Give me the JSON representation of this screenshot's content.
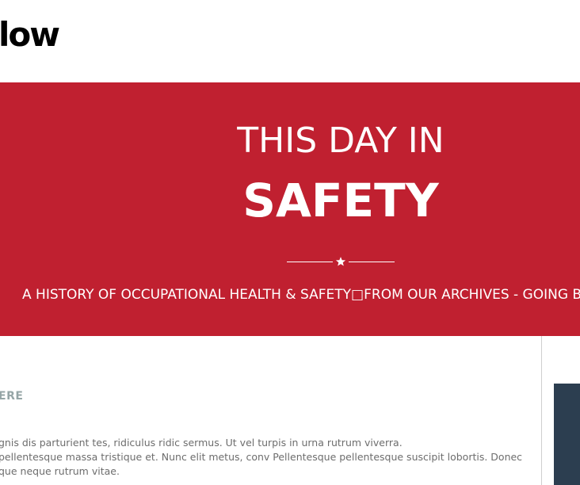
{
  "header": {
    "logo_text": "low"
  },
  "hero": {
    "line1": "THIS DAY IN",
    "line2": "SAFETY",
    "divider_icon": "star-icon",
    "tagline": "A HISTORY OF OCCUPATIONAL HEALTH & SAFETY□FROM OUR ARCHIVES - GOING BA"
  },
  "content": {
    "section_heading": "ERE",
    "body_lines": [
      "gnis dis parturient tes, ridiculus ridic sermus. Ut vel turpis in urna rutrum viverra.",
      "pellentesque massa tristique et. Nunc elit metus, conv Pellentesque pellentesque suscipit lobortis. Donec",
      "que neque rutrum vitae."
    ]
  },
  "colors": {
    "hero_background": "#c02030",
    "sidebar_box": "#2c3e50",
    "heading_gray": "#95a5a6"
  }
}
